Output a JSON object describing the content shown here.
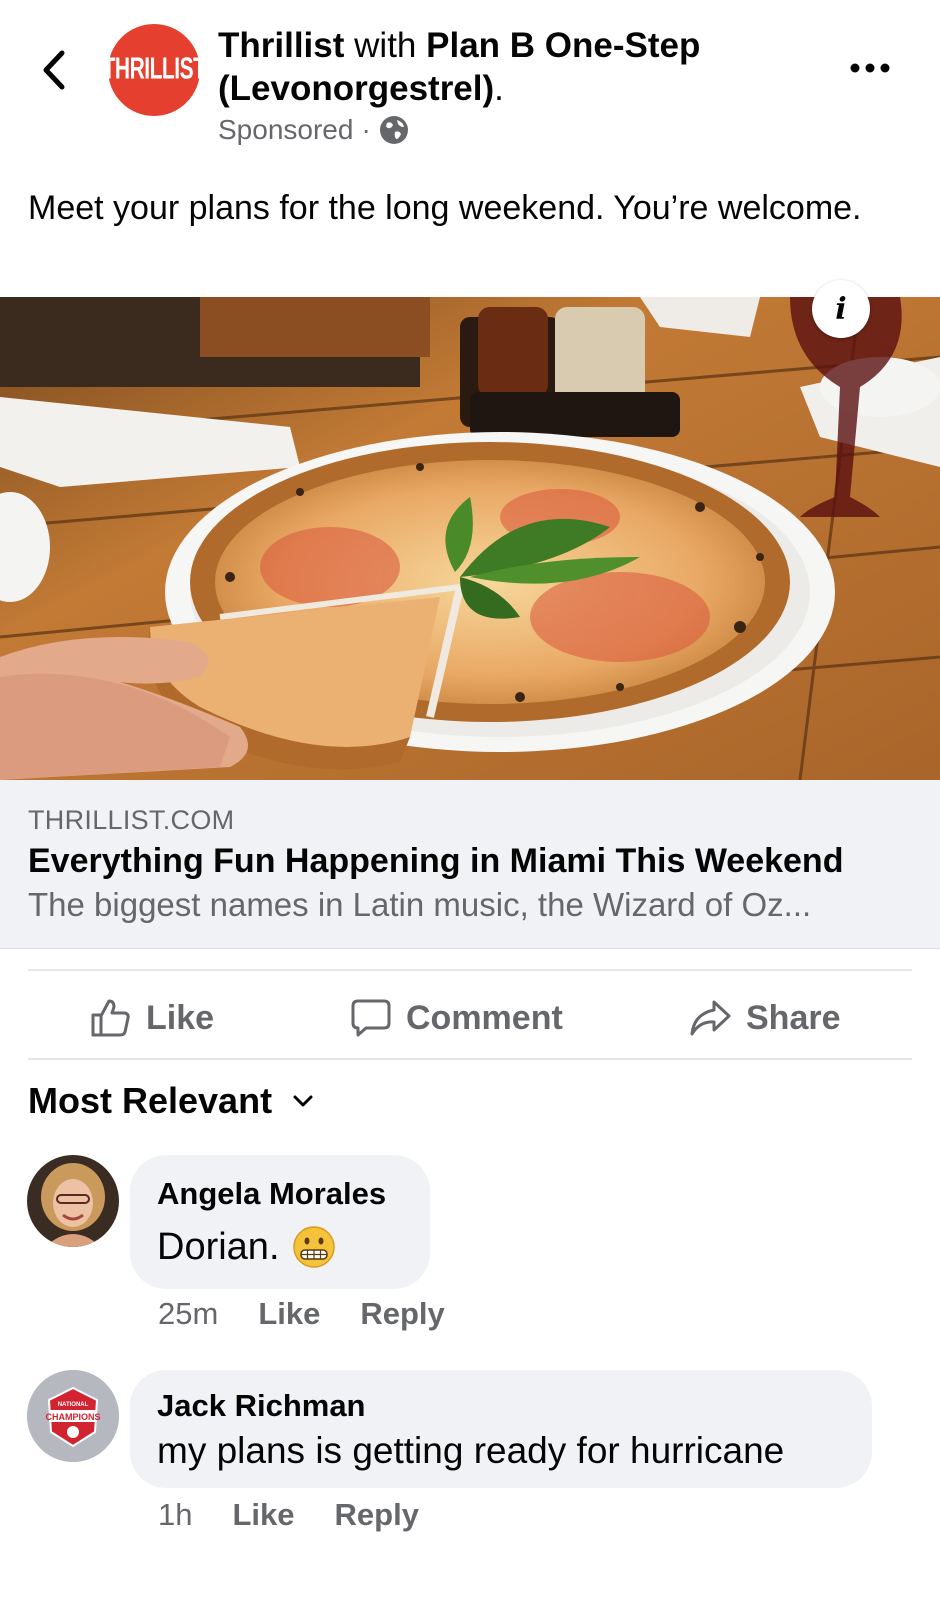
{
  "header": {
    "page_name": "Thrillist",
    "with_word": "with",
    "partner_name": "Plan B One-Step (Levonorgestrel)",
    "period": ".",
    "sponsored": "Sponsored",
    "separator": "·",
    "logo_text": "THRILLIST",
    "logo_color": "#e5402f",
    "back_icon": "chevron-left-icon",
    "more_icon": "more-horizontal-icon",
    "privacy_icon": "globe-icon"
  },
  "post": {
    "text": "Meet your plans for the long weekend. You’re welcome.",
    "image_alt": "pizza-photo",
    "info_icon": "info-icon"
  },
  "link": {
    "domain": "THRILLIST.COM",
    "title": "Everything Fun Happening in Miami This Weekend",
    "description": "The biggest names in Latin music, the Wizard of Oz..."
  },
  "actions": {
    "like": "Like",
    "comment": "Comment",
    "share": "Share"
  },
  "comments_sort": {
    "label": "Most Relevant"
  },
  "comments": [
    {
      "name": "Angela Morales",
      "text": "Dorian.",
      "emoji": "grimacing-face-emoji",
      "time": "25m",
      "like": "Like",
      "reply": "Reply"
    },
    {
      "name": "Jack Richman",
      "text": "my plans is getting ready for hurricane",
      "avatar_badge": "NATIONAL CHAMPIONS",
      "time": "1h",
      "like": "Like",
      "reply": "Reply"
    }
  ],
  "colors": {
    "secondary_text": "#65676b",
    "bubble_bg": "#f0f2f5",
    "link_box_bg": "#f0f2f5"
  }
}
